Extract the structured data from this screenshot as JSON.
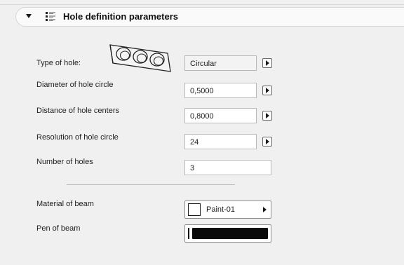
{
  "section": {
    "title": "Hole definition parameters",
    "icon": "parameter-list-icon"
  },
  "params": {
    "type_of_hole": {
      "label": "Type of hole:",
      "value": "Circular"
    },
    "diameter": {
      "label": "Diameter of hole circle",
      "value": "0,5000"
    },
    "distance": {
      "label": "Distance of hole centers",
      "value": "0,8000"
    },
    "resolution": {
      "label": "Resolution of hole circle",
      "value": "24"
    },
    "number": {
      "label": "Number of holes",
      "value": "3"
    },
    "material": {
      "label": "Material of beam",
      "value": "Paint-01"
    },
    "pen": {
      "label": "Pen of beam"
    }
  },
  "colors": {
    "background": "#f0f0f0",
    "field_border": "#b9b9b9",
    "pen_color": "#0a0a0a"
  }
}
